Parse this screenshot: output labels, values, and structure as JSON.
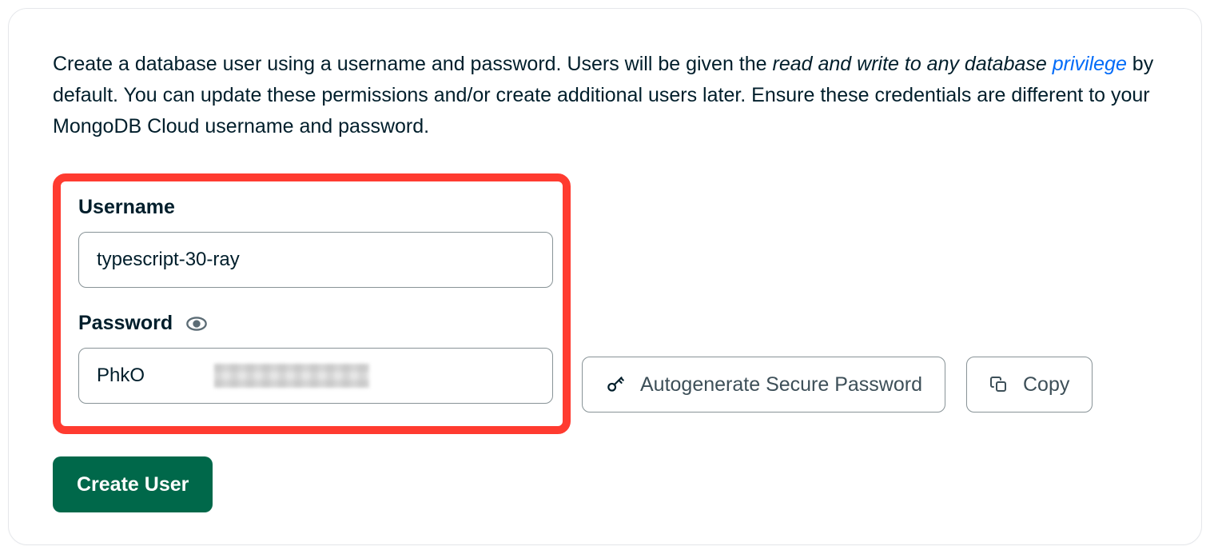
{
  "description": {
    "text_before_italic": "Create a database user using a username and password. Users will be given the ",
    "italic_part": "read and write to any database ",
    "link_text": "privilege",
    "text_after_link": " by default. You can update these permissions and/or create additional users later. Ensure these credentials are different to your MongoDB Cloud username and password."
  },
  "fields": {
    "username": {
      "label": "Username",
      "value": "typescript-30-ray"
    },
    "password": {
      "label": "Password",
      "value": "PhkO"
    }
  },
  "buttons": {
    "autogenerate": "Autogenerate Secure Password",
    "copy": "Copy",
    "create_user": "Create User"
  }
}
